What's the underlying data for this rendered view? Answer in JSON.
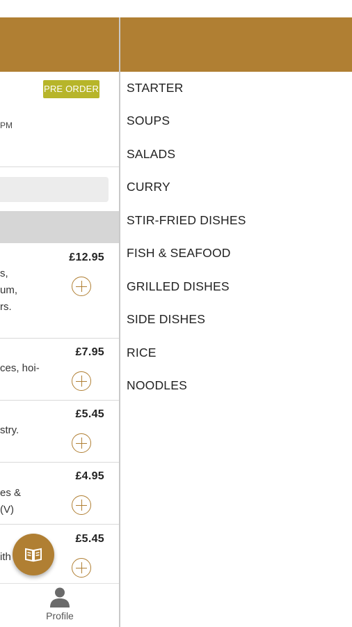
{
  "order_badge": "PRE ORDER",
  "time_fragment": "PM",
  "menu_items": [
    {
      "price": "£12.95",
      "desc": "s,\num,\nrs."
    },
    {
      "price": "£7.95",
      "desc": "ces, hoi-"
    },
    {
      "price": "£5.45",
      "desc": "stry."
    },
    {
      "price": "£4.95",
      "desc": "es &\n(V)"
    },
    {
      "price": "£5.45",
      "desc": "ith"
    }
  ],
  "bottom_nav": {
    "profile_label": "Profile"
  },
  "categories": [
    "STARTER",
    "SOUPS",
    "SALADS",
    "CURRY",
    "STIR-FRIED DISHES",
    "FISH & SEAFOOD",
    "GRILLED DISHES",
    "SIDE DISHES",
    "RICE",
    "NOODLES"
  ],
  "colors": {
    "brand": "#b07f33",
    "badge": "#b7b52a"
  },
  "icons": {
    "fab": "menu-book-icon",
    "profile": "person-icon",
    "add": "plus-circle-icon"
  }
}
